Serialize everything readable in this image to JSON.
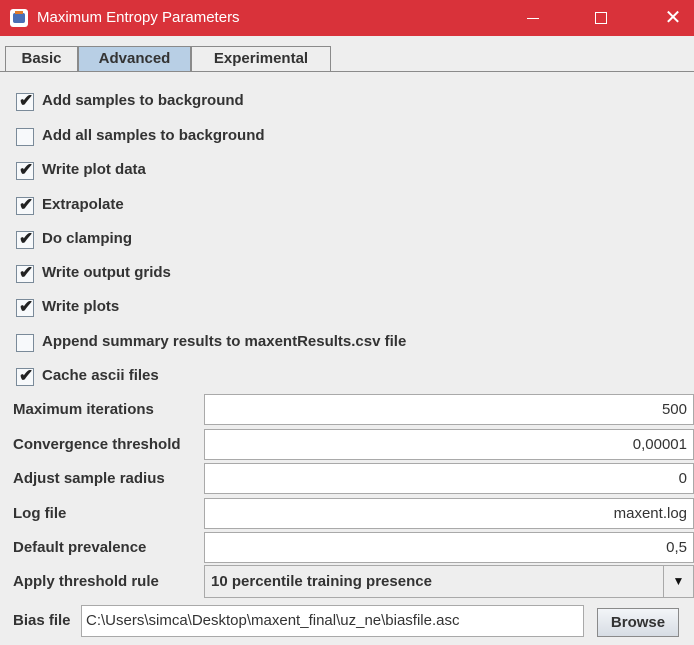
{
  "window": {
    "title": "Maximum Entropy Parameters"
  },
  "tabs": [
    {
      "label": "Basic",
      "active": false
    },
    {
      "label": "Advanced",
      "active": true
    },
    {
      "label": "Experimental",
      "active": false
    }
  ],
  "checkboxes": [
    {
      "label": "Add samples to background",
      "checked": true
    },
    {
      "label": "Add all samples to background",
      "checked": false
    },
    {
      "label": "Write plot data",
      "checked": true
    },
    {
      "label": "Extrapolate",
      "checked": true
    },
    {
      "label": "Do clamping",
      "checked": true
    },
    {
      "label": "Write output grids",
      "checked": true
    },
    {
      "label": "Write plots",
      "checked": true
    },
    {
      "label": "Append summary results to maxentResults.csv file",
      "checked": false
    },
    {
      "label": "Cache ascii files",
      "checked": true
    }
  ],
  "check_mark": "✔",
  "fields": [
    {
      "label": "Maximum iterations",
      "value": "500"
    },
    {
      "label": "Convergence threshold",
      "value": "0,00001"
    },
    {
      "label": "Adjust sample radius",
      "value": "0"
    },
    {
      "label": "Log file",
      "value": "maxent.log"
    },
    {
      "label": "Default prevalence",
      "value": "0,5"
    }
  ],
  "threshold_rule": {
    "label": "Apply threshold rule",
    "value": "10 percentile training presence"
  },
  "bias_file": {
    "label": "Bias file",
    "value": "C:\\Users\\simca\\Desktop\\maxent_final\\uz_ne\\biasfile.asc",
    "browse_label": "Browse"
  },
  "colors": {
    "titlebar": "#d9323a",
    "active_tab": "#b8cfe5",
    "panel": "#eeeeee"
  }
}
